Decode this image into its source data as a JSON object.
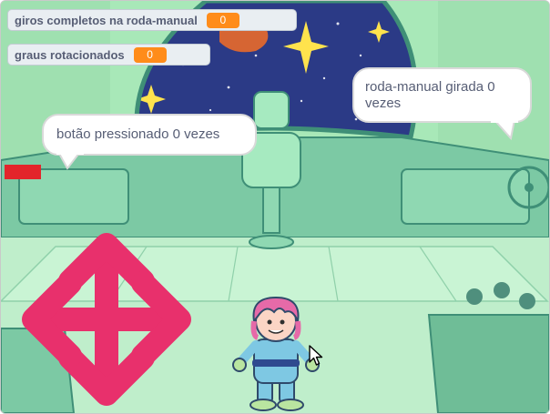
{
  "monitors": {
    "turns": {
      "label": "giros completos na roda-manual",
      "value": "0"
    },
    "degrees": {
      "label": "graus rotacionados",
      "value": "0"
    }
  },
  "bubbles": {
    "button": {
      "text": "botão pressionado 0 vezes"
    },
    "wheel": {
      "text": "roda-manual girada 0 vezes"
    }
  },
  "colors": {
    "monitor_value": "#ff8c1a",
    "arrows": "#e8306c",
    "window_space": "#2b3a86",
    "backdrop": "#a8e8b8"
  },
  "icons": {
    "arrows": "four-way-arrow-icon",
    "cursor": "mouse-pointer-icon"
  }
}
